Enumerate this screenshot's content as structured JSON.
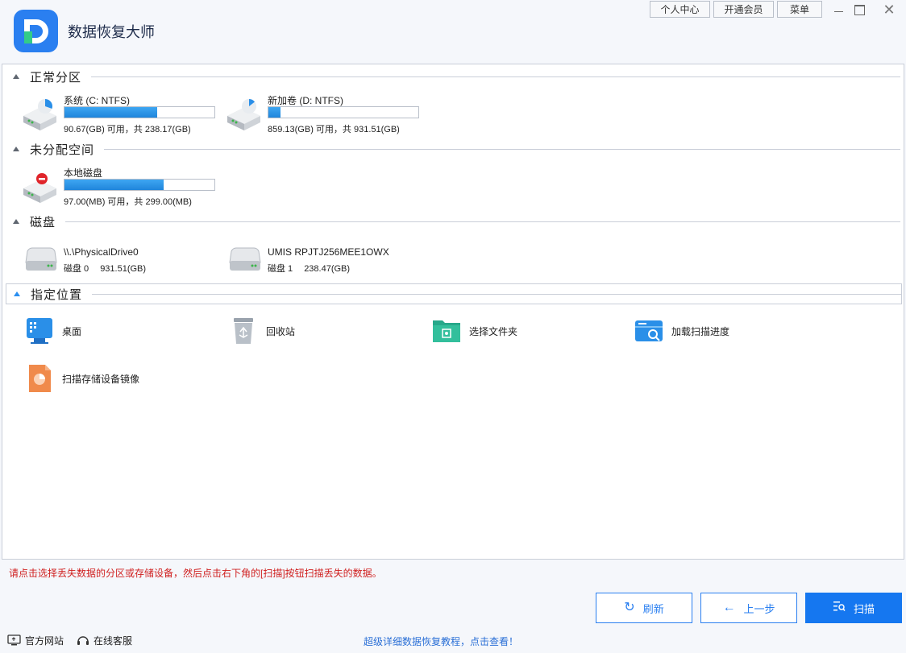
{
  "app": {
    "title": "数据恢复大师"
  },
  "topbar": {
    "personal_center": "个人中心",
    "vip": "开通会员",
    "menu": "菜单"
  },
  "sections": {
    "normal_partitions": "正常分区",
    "unallocated": "未分配空间",
    "disks": "磁盘",
    "locations": "指定位置"
  },
  "partitions": [
    {
      "name": "系统 (C: NTFS)",
      "info": "90.67(GB) 可用，共 238.17(GB)",
      "used_fraction": 0.62
    },
    {
      "name": "新加卷 (D: NTFS)",
      "info": "859.13(GB) 可用，共 931.51(GB)",
      "used_fraction": 0.08
    }
  ],
  "unallocated": [
    {
      "name": "本地磁盘",
      "info": "97.00(MB) 可用，共 299.00(MB)",
      "used_fraction": 0.66
    }
  ],
  "disks": [
    {
      "name": "\\\\.\\PhysicalDrive0",
      "label": "磁盘 0",
      "size": "931.51(GB)"
    },
    {
      "name": "UMIS RPJTJ256MEE1OWX",
      "label": "磁盘 1",
      "size": "238.47(GB)"
    }
  ],
  "locations": [
    {
      "label": "桌面",
      "icon": "desktop-icon"
    },
    {
      "label": "回收站",
      "icon": "recycle-bin-icon"
    },
    {
      "label": "选择文件夹",
      "icon": "folder-icon"
    },
    {
      "label": "加载扫描进度",
      "icon": "scan-progress-icon"
    },
    {
      "label": "扫描存储设备镜像",
      "icon": "disk-image-icon"
    }
  ],
  "hint": "请点击选择丢失数据的分区或存储设备，然后点击右下角的[扫描]按钮扫描丢失的数据。",
  "buttons": {
    "refresh": "刷新",
    "back": "上一步",
    "scan": "扫描"
  },
  "footer": {
    "website": "官方网站",
    "support": "在线客服",
    "tutorial": "超级详细数据恢复教程，点击查看！"
  },
  "colors": {
    "accent": "#1577f0",
    "progress": "#2a8fe8",
    "hint": "#d02020"
  }
}
